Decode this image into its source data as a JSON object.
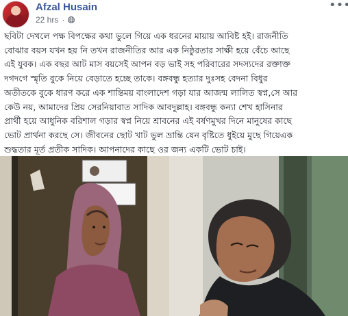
{
  "post": {
    "author_name": "Afzal Husain",
    "timestamp": "22 hrs",
    "privacy_icon": "globe-icon",
    "menu_icon": "more-options-icon",
    "body_text": "ছবিটা দেখলে পক্ষ বিপক্ষের কথা ভুলে গিয়ে এক ধরনের মায়ায় আবিষ্ট হই। রাজনীতি\nবোঝার বয়স যখন হয় নি তখন রাজনীতির আর এক নিষ্ঠুরতার সাক্ষী হয়ে বেঁচে আছে\nএই যুবক। এক বছর আট মাস বয়সেই আপন বড় ভাই সহ পরিবারের সদস্যদের রক্তাক্ত\nদগদগে স্মৃতি বুকে নিয়ে বেড়াতে হচ্ছে তাকে। বঙ্গবন্ধু হত্যার দুঃসহ বেদনা বিধুর\nঅতীতকে বুকে ধারণ করে এক শান্তিময় বাংলাদেশ গড়া যার আজন্ম লালিত স্বপ্ন,সে আর\nকেউ নয়, আমাদের প্রিয় সেরনিয়াবাত সাদিক আবদুল্লাহ। বঙ্গবন্ধু কন্যা শেখ হাসিনার\nপ্রার্থী হয়ে আধুনিক বরিশাল গড়ার স্বপ্ন নিয়ে শ্রাবনের এই বর্ষণমুখর দিনে মানুষের কাছে\nভোট প্রার্থনা করছে সে। জীবনের ছোট খাট ভুল ভ্রান্তি যেন বৃষ্টিতে ধুইয়ে মুছে গিয়েএক\nশুদ্ধতার মূর্ত প্রতীক সাদিক। আপনাদের কাছে ওর জন্য একটি ভোট চাই।"
  }
}
